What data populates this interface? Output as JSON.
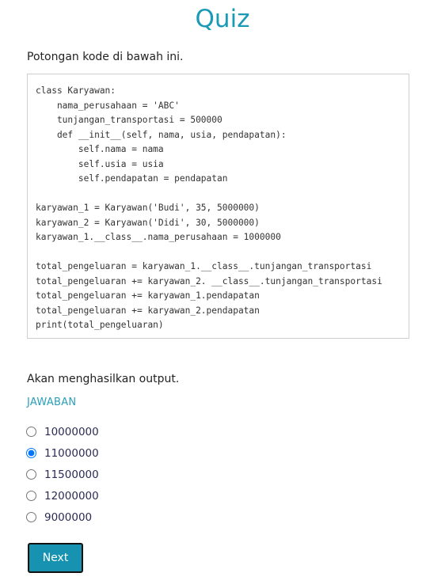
{
  "title": "Quiz",
  "prompt": "Potongan kode di bawah ini.",
  "code": "class Karyawan:\n    nama_perusahaan = 'ABC'\n    tunjangan_transportasi = 500000\n    def __init__(self, nama, usia, pendapatan):\n        self.nama = nama\n        self.usia = usia\n        self.pendapatan = pendapatan\n\nkaryawan_1 = Karyawan('Budi', 35, 5000000)\nkaryawan_2 = Karyawan('Didi', 30, 5000000)\nkaryawan_1.__class__.nama_perusahaan = 1000000\n\ntotal_pengeluaran = karyawan_1.__class__.tunjangan_transportasi\ntotal_pengeluaran += karyawan_2. __class__.tunjangan_transportasi\ntotal_pengeluaran += karyawan_1.pendapatan\ntotal_pengeluaran += karyawan_2.pendapatan\nprint(total_pengeluaran)",
  "after_text": "Akan menghasilkan output.",
  "answer_label": "JAWABAN",
  "options": [
    {
      "label": "10000000",
      "selected": false
    },
    {
      "label": "11000000",
      "selected": true
    },
    {
      "label": "11500000",
      "selected": false
    },
    {
      "label": "12000000",
      "selected": false
    },
    {
      "label": "9000000",
      "selected": false
    }
  ],
  "next_label": "Next",
  "colors": {
    "accent": "#1b9ab6",
    "button": "#1792b0"
  }
}
